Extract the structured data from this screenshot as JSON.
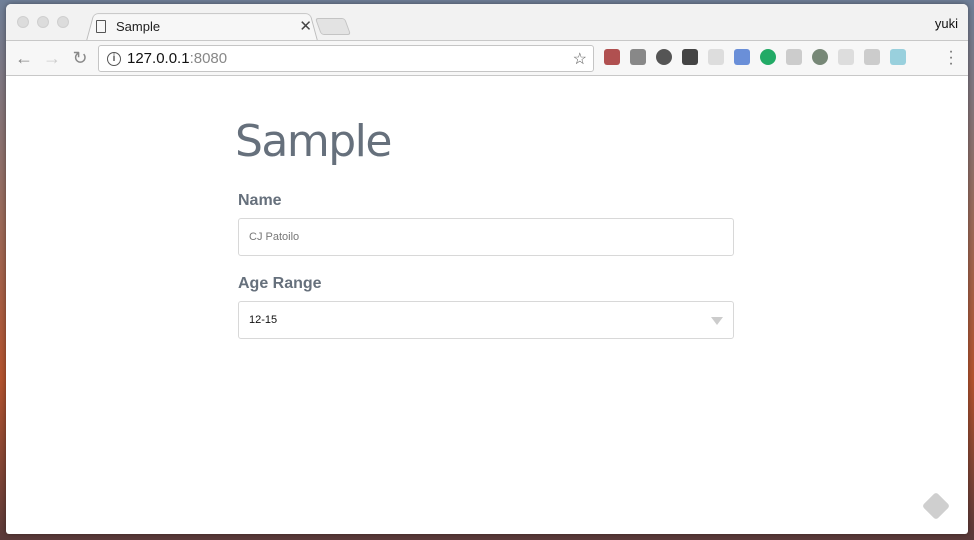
{
  "browser": {
    "tab_title": "Sample",
    "profile_name": "yuki",
    "url_host": "127.0.0.1",
    "url_port": ":8080",
    "extension_icons": [
      "evernote-icon",
      "pocket-icon",
      "speedometer-icon",
      "qr-code-icon",
      "extension-icon",
      "translate-icon",
      "grammarly-icon",
      "drive-icon",
      "globe-icon",
      "extension-icon",
      "puzzle-icon",
      "extension-icon"
    ],
    "extension_colors": [
      "#b05050",
      "#888888",
      "#555555",
      "#444444",
      "#dddddd",
      "#6a8fd8",
      "#22aa66",
      "#cccccc",
      "#778877",
      "#dddddd",
      "#cccccc",
      "#99d0dd"
    ]
  },
  "page": {
    "title": "Sample",
    "name_label": "Name",
    "name_placeholder": "CJ Patoilo",
    "age_label": "Age Range",
    "age_selected": "12-15"
  }
}
